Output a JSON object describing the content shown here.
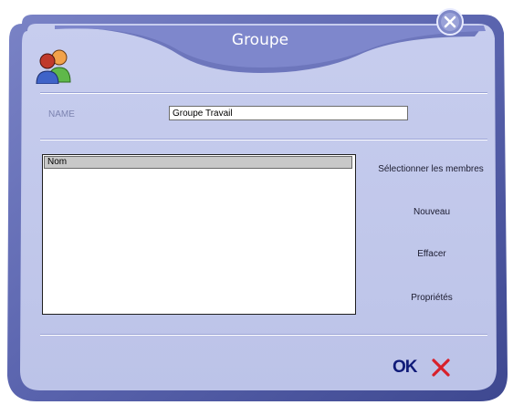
{
  "dialog": {
    "title": "Groupe"
  },
  "name_field": {
    "label": "NAME",
    "value": "Groupe Travail"
  },
  "members_list": {
    "column_header": "Nom",
    "rows": []
  },
  "actions": {
    "select_members": "Sélectionner les membres",
    "new": "Nouveau",
    "delete": "Effacer",
    "properties": "Propriétés"
  },
  "footer": {
    "ok_label": "OK"
  },
  "icons": {
    "close": "close-icon",
    "group": "group-icon",
    "cancel": "cancel-icon"
  },
  "colors": {
    "panel": "#c3c9ec",
    "frame": "#6d76bc",
    "ok": "#0f1a78",
    "cancel": "#d8202a"
  }
}
